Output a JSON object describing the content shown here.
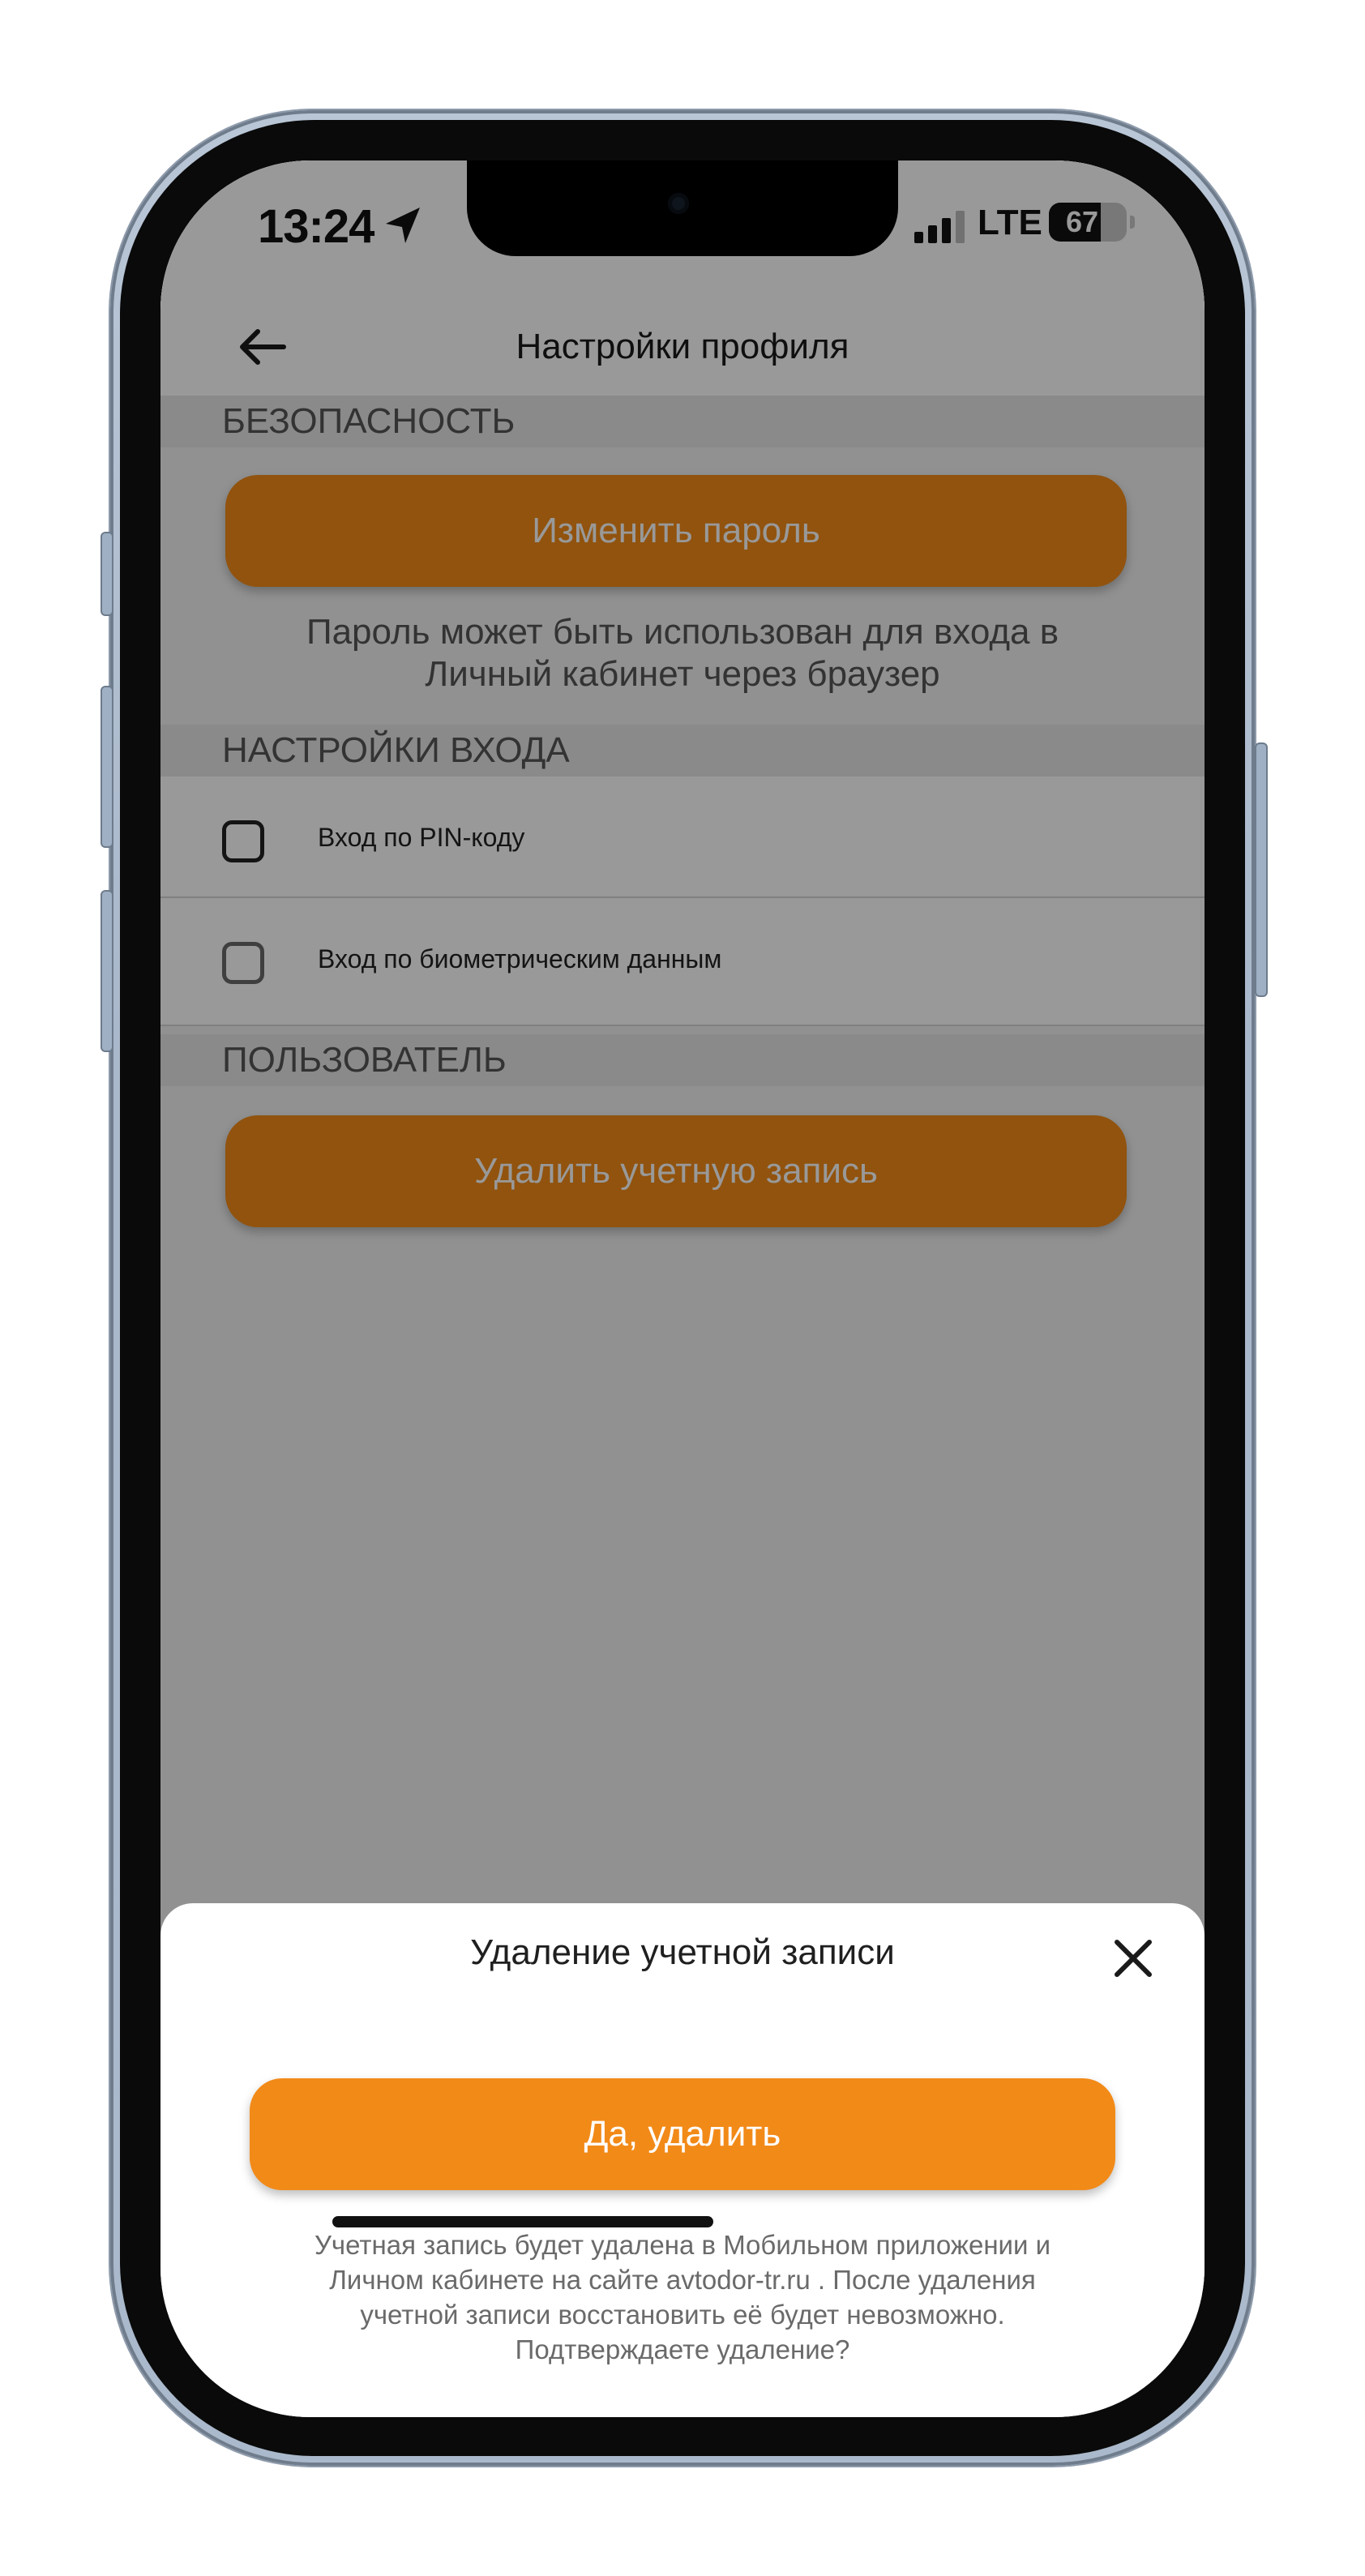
{
  "status_bar": {
    "time": "13:24",
    "network": "LTE",
    "battery": "67",
    "battery_level": 0.67
  },
  "header": {
    "title": "Настройки профиля",
    "back_icon": "arrow-left-icon"
  },
  "security": {
    "section_title": "БЕЗОПАСНОСТЬ",
    "change_password_label": "Изменить пароль",
    "hint_line1": "Пароль может быть использован для входа в",
    "hint_line2": "Личный кабинет через браузер"
  },
  "login_settings": {
    "section_title": "НАСТРОЙКИ ВХОДА",
    "items": [
      {
        "label": "Вход по PIN-коду",
        "checked": false
      },
      {
        "label": "Вход по биометрическим данным",
        "checked": false
      }
    ]
  },
  "user": {
    "section_title": "ПОЛЬЗОВАТЕЛЬ",
    "delete_account_label": "Удалить учетную запись"
  },
  "dialog": {
    "title": "Удаление учетной записи",
    "confirm_label": "Да, удалить",
    "text_line1": "Учетная запись будет удалена в Мобильном приложении и",
    "text_line2": "Личном кабинете на сайте avtodor-tr.ru . После удаления",
    "text_line3": "учетной записи восстановить её будет невозможно.",
    "text_line4": "Подтверждаете удаление?",
    "close_icon": "close-icon"
  },
  "colors": {
    "accent": "#f28a18",
    "overlay": "rgba(0,0,0,0.4)"
  }
}
